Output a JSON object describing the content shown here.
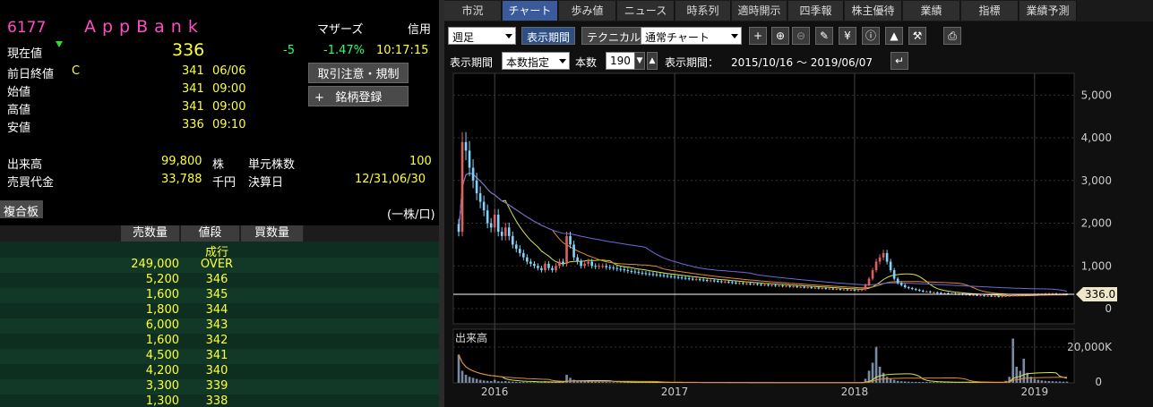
{
  "stock": {
    "code": "6177",
    "name": "AppBank",
    "market": "マザーズ",
    "margin": "信用",
    "current_label": "現在値",
    "current_price": "336",
    "change": "-5",
    "change_pct": "-1.47%",
    "time": "10:17:15"
  },
  "quote": {
    "prev_close_label": "前日終値",
    "prev_close_flag": "C",
    "prev_close": "341",
    "prev_close_date": "06/06",
    "open_label": "始値",
    "open": "341",
    "open_time": "09:00",
    "high_label": "高値",
    "high": "341",
    "high_time": "09:00",
    "low_label": "安値",
    "low": "336",
    "low_time": "09:10",
    "volume_label": "出来高",
    "volume": "99,800",
    "volume_unit": "株",
    "unit_label": "単元株数",
    "unit": "100",
    "turnover_label": "売買代金",
    "turnover": "33,788",
    "turnover_unit": "千円",
    "settle_label": "決算日",
    "settle": "12/31,06/30"
  },
  "buttons": {
    "rules": "取引注意・規制",
    "register": "銘柄登録",
    "register_plus": "+",
    "fukugo": "複合板",
    "unit_note": "(一株/口)"
  },
  "board": {
    "headers": [
      "売数量",
      "値段",
      "買数量"
    ],
    "rows": [
      {
        "vol": "",
        "price": "成行"
      },
      {
        "vol": "249,000",
        "price": "OVER"
      },
      {
        "vol": "5,200",
        "price": "346"
      },
      {
        "vol": "1,600",
        "price": "345"
      },
      {
        "vol": "1,800",
        "price": "344"
      },
      {
        "vol": "6,000",
        "price": "343"
      },
      {
        "vol": "1,600",
        "price": "342"
      },
      {
        "vol": "4,500",
        "price": "341"
      },
      {
        "vol": "4,200",
        "price": "340"
      },
      {
        "vol": "3,300",
        "price": "339"
      },
      {
        "vol": "1,300",
        "price": "338"
      }
    ]
  },
  "tabs": [
    "市況",
    "チャート",
    "歩み値",
    "ニュース",
    "時系列",
    "適時開示",
    "四季報",
    "株主優待",
    "業績",
    "指標",
    "業績予測"
  ],
  "active_tab": "チャート",
  "toolbar": {
    "period": "週足",
    "display_period_btn": "表示期間",
    "technical_btn": "テクニカル",
    "chart_type": "通常チャート",
    "icons": [
      "plus-icon",
      "zoom-in-icon",
      "zoom-out-icon",
      "pencil-icon",
      "yen-icon",
      "info-icon",
      "area-chart-icon",
      "wrench-icon",
      "print-icon"
    ]
  },
  "toolbar2": {
    "period_label": "表示期間",
    "period_mode": "本数指定",
    "count_label": "本数",
    "count": "190",
    "range_label": "表示期間：",
    "range": "2015/10/16 ～ 2019/06/07"
  },
  "colors": {
    "up": "#e06060",
    "down": "#7fd4ff",
    "ma_short": "#d4e64a",
    "ma_mid": "#e08a3a",
    "ma_long": "#6a6adc",
    "current_line": "#ffffff",
    "label_bg": "#f0e6c8"
  },
  "chart_data": {
    "type": "candlestick",
    "price_ticks": [
      "5,000",
      "4,000",
      "3,000",
      "2,000",
      "1,000",
      "0"
    ],
    "current_label": "336.0",
    "volume_title": "出来高",
    "volume_tick": "20,000K",
    "volume_tick_zero": "0",
    "x_ticks": [
      "2016",
      "2017",
      "2018",
      "2019"
    ],
    "ylim": [
      0,
      5000
    ],
    "close_series": [
      1800,
      3900,
      3700,
      3300,
      3000,
      2700,
      2500,
      2300,
      2000,
      1900,
      2200,
      1800,
      1700,
      1900,
      1700,
      1500,
      1400,
      1300,
      1200,
      1100,
      1050,
      1000,
      950,
      900,
      1050,
      950,
      900,
      1000,
      1100,
      1050,
      1700,
      1500,
      1200,
      1100,
      1000,
      1050,
      1100,
      1000,
      980,
      1000,
      1000,
      970,
      960,
      950,
      930,
      920,
      900,
      880,
      870,
      860,
      840,
      830,
      820,
      810,
      800,
      790,
      780,
      770,
      760,
      750,
      740,
      730,
      720,
      710,
      700,
      690,
      690,
      680,
      670,
      660,
      660,
      650,
      640,
      630,
      630,
      620,
      610,
      600,
      600,
      590,
      590,
      580,
      580,
      570,
      560,
      560,
      550,
      550,
      540,
      540,
      530,
      530,
      520,
      520,
      510,
      510,
      500,
      500,
      490,
      490,
      480,
      480,
      470,
      470,
      460,
      460,
      450,
      450,
      440,
      440,
      430,
      430,
      450,
      550,
      700,
      900,
      1100,
      1200,
      1300,
      1100,
      900,
      700,
      600,
      550,
      500,
      480,
      460,
      440,
      420,
      400,
      400,
      380,
      380,
      370,
      360,
      360,
      350,
      350,
      340,
      340,
      330,
      330,
      320,
      320,
      310,
      310,
      300,
      300,
      290,
      290,
      280,
      290,
      300,
      300,
      310,
      310,
      320,
      320,
      330,
      330,
      340,
      340,
      340,
      350,
      350,
      350,
      340,
      340,
      340,
      336
    ],
    "volume_series_k": [
      14000,
      6000,
      4000,
      3000,
      2500,
      2000,
      1500,
      1200,
      1000,
      900,
      1500,
      800,
      700,
      900,
      700,
      600,
      500,
      450,
      400,
      350,
      300,
      300,
      280,
      260,
      800,
      500,
      400,
      500,
      600,
      500,
      4000,
      2500,
      1500,
      1000,
      800,
      700,
      900,
      600,
      500,
      500,
      400,
      400,
      350,
      350,
      300,
      300,
      300,
      280,
      280,
      260,
      250,
      250,
      240,
      240,
      230,
      230,
      220,
      220,
      210,
      210,
      200,
      200,
      200,
      190,
      190,
      190,
      180,
      180,
      180,
      170,
      170,
      170,
      160,
      160,
      160,
      150,
      150,
      150,
      150,
      140,
      140,
      140,
      140,
      130,
      130,
      130,
      130,
      130,
      120,
      120,
      120,
      120,
      120,
      110,
      110,
      110,
      110,
      110,
      100,
      100,
      100,
      100,
      100,
      100,
      100,
      100,
      100,
      100,
      100,
      100,
      100,
      100,
      300,
      2000,
      6000,
      10000,
      18000,
      8000,
      5000,
      3000,
      2000,
      1500,
      1000,
      800,
      700,
      600,
      500,
      500,
      450,
      400,
      400,
      380,
      360,
      340,
      320,
      300,
      300,
      280,
      280,
      260,
      250,
      250,
      240,
      240,
      230,
      230,
      220,
      220,
      210,
      210,
      200,
      400,
      1000,
      3000,
      22000,
      8000,
      6000,
      12000,
      5000,
      3000,
      2000,
      1500,
      1200,
      1000,
      900,
      800,
      700,
      700,
      600,
      600
    ]
  }
}
